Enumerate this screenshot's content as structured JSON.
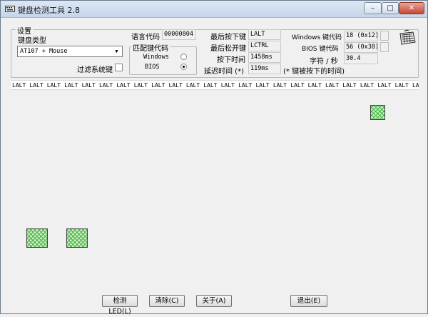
{
  "window": {
    "title": "键盘检测工具 2.8",
    "minimize": "–",
    "maximize": "□",
    "close": "✕"
  },
  "settings": {
    "group_title": "设置",
    "keyboard_type_label": "键盘类型",
    "keyboard_type_value": "AT107 + Mouse",
    "filter_label": "过滤系统键",
    "language_label": "语言代码",
    "language_value": "00000804",
    "match_group_title": "匹配键代码",
    "radio_windows": "Windows",
    "radio_bios": "BIOS",
    "selected_mode": "BIOS"
  },
  "readouts": {
    "last_down_label": "最后按下键",
    "last_down_value": "LALT",
    "last_up_label": "最后松开键",
    "last_up_value": "LCTRL",
    "press_time_label": "按下时间",
    "press_time_value": "1458ms",
    "delay_label": "延迟时间 (*)",
    "delay_value": "119ms",
    "delay_note": "(* 键被按下的时间)",
    "windows_code_label": "Windows 键代码",
    "windows_code_value": "18 (0x12)",
    "bios_code_label": "BIOS 键代码",
    "bios_code_value": "56 (0x38)",
    "rate_label": "字符 / 秒",
    "rate_value": "30.4"
  },
  "history": [
    "LALT",
    "LALT",
    "LALT",
    "LALT",
    "LALT",
    "LALT",
    "LALT",
    "LALT",
    "LALT",
    "LALT",
    "LALT",
    "LALT",
    "LALT",
    "LALT",
    "LALT",
    "LALT",
    "LALT",
    "LALT",
    "LALT",
    "LALT",
    "LALT",
    "LALT",
    "LALT",
    "LA"
  ],
  "colors": {
    "key_fill": "#c8f0c0",
    "key_hatch": "#48b048"
  },
  "buttons": {
    "led": "检测LED(L)",
    "clear": "清除(C)",
    "about": "关于(A)",
    "exit": "退出(E)"
  }
}
